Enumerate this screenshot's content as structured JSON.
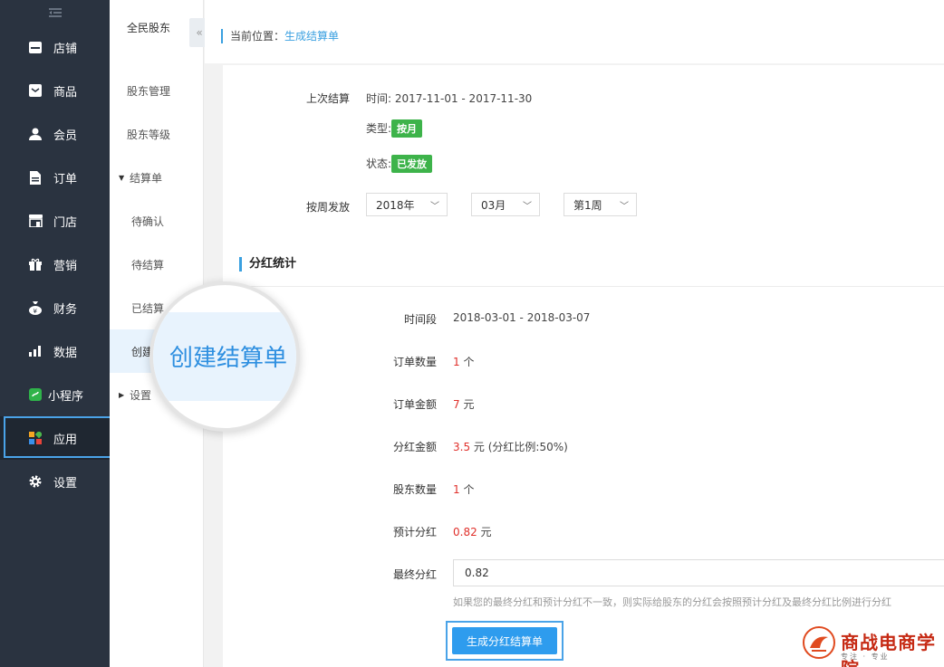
{
  "sidebar": {
    "items": [
      {
        "label": "店铺",
        "icon": "store-icon"
      },
      {
        "label": "商品",
        "icon": "goods-icon"
      },
      {
        "label": "会员",
        "icon": "member-icon"
      },
      {
        "label": "订单",
        "icon": "order-icon"
      },
      {
        "label": "门店",
        "icon": "shop-icon"
      },
      {
        "label": "营销",
        "icon": "gift-icon"
      },
      {
        "label": "财务",
        "icon": "money-bag-icon"
      },
      {
        "label": "数据",
        "icon": "chart-icon"
      },
      {
        "label": "小程序",
        "icon": "mini-program-icon"
      },
      {
        "label": "应用",
        "icon": "apps-icon"
      },
      {
        "label": "设置",
        "icon": "gear-icon"
      }
    ]
  },
  "subnav": {
    "title": "全民股东",
    "items": [
      {
        "label": "股东管理"
      },
      {
        "label": "股东等级"
      },
      {
        "label": "结算单"
      },
      {
        "label": "待确认"
      },
      {
        "label": "待结算"
      },
      {
        "label": "已结算"
      },
      {
        "label": "创建"
      },
      {
        "label": "设置"
      }
    ]
  },
  "breadcrumb": {
    "prefix": "当前位置：",
    "current": "生成结算单"
  },
  "last_settlement": {
    "label": "上次结算",
    "time_label": "时间: ",
    "time_value": "2017-11-01 - 2017-11-30",
    "type_label": "类型:",
    "type_value": "按月",
    "status_label": "状态:",
    "status_value": "已发放"
  },
  "weekly": {
    "label": "按周发放",
    "year": "2018年",
    "month": "03月",
    "week": "第1周"
  },
  "stats": {
    "section_title": "分红统计",
    "period_label": "时间段",
    "period_value": "2018-03-01 - 2018-03-07",
    "order_count_label": "订单数量",
    "order_count_value": "1",
    "order_count_unit": " 个",
    "order_amount_label": "订单金额",
    "order_amount_value": "7",
    "order_amount_unit": " 元",
    "dividend_amount_label": "分红金额",
    "dividend_amount_value": "3.5",
    "dividend_amount_unit": " 元 (分红比例:50%)",
    "holder_count_label": "股东数量",
    "holder_count_value": "1",
    "holder_count_unit": " 个",
    "estimated_label": "预计分红",
    "estimated_value": "0.82",
    "estimated_unit": " 元",
    "final_label": "最终分红",
    "final_value": "0.82",
    "hint": "如果您的最终分红和预计分红不一致，则实际给股东的分红会按照预计分红及最终分红比例进行分红"
  },
  "button": {
    "generate": "生成分红结算单"
  },
  "magnifier": {
    "text": "创建结算单"
  },
  "watermark": {
    "name": "商战电商学院",
    "sub": "专注 · 专业"
  },
  "colors": {
    "accent": "#2e9cee",
    "tag_green": "#3db34a",
    "value_red": "#e0302b",
    "sidebar_bg": "#2a3340"
  }
}
